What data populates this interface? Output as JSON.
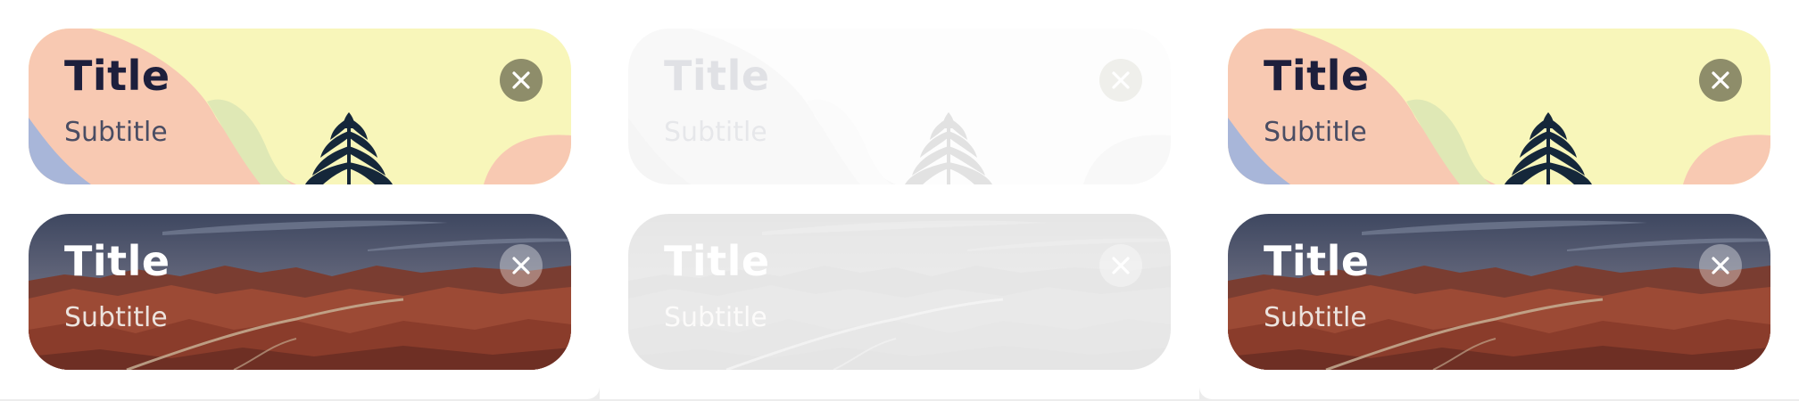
{
  "cards": [
    {
      "title": "Title",
      "subtitle": "Subtitle",
      "close_icon": "close-icon",
      "theme": "light",
      "state": "enabled"
    },
    {
      "title": "Title",
      "subtitle": "Subtitle",
      "close_icon": "close-icon",
      "theme": "dark",
      "state": "enabled"
    },
    {
      "title": "Title",
      "subtitle": "Subtitle",
      "close_icon": "close-icon",
      "theme": "light",
      "state": "disabled"
    },
    {
      "title": "Title",
      "subtitle": "Subtitle",
      "close_icon": "close-icon",
      "theme": "dark",
      "state": "disabled"
    },
    {
      "title": "Title",
      "subtitle": "Subtitle",
      "close_icon": "close-icon",
      "theme": "light",
      "state": "enabled"
    },
    {
      "title": "Title",
      "subtitle": "Subtitle",
      "close_icon": "close-icon",
      "theme": "dark",
      "state": "enabled"
    }
  ],
  "colors": {
    "light_bg": "#f8f6ba",
    "light_title": "#1d1f3c",
    "light_close_bg": "#8e8d6a",
    "dark_sky": "#4b5570",
    "dark_rock": "#9a4a34",
    "dark_title": "#ffffff"
  }
}
